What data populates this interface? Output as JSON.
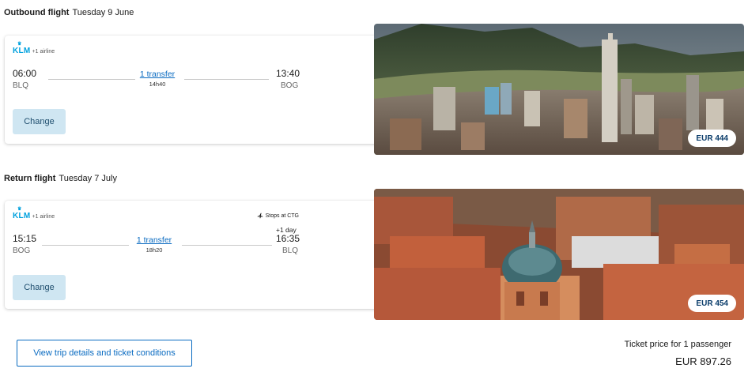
{
  "outbound": {
    "label": "Outbound flight",
    "date": "Tuesday 9 June",
    "airline_name": "KLM",
    "airline_extra": "+1 airline",
    "depart_time": "06:00",
    "depart_code": "BLQ",
    "arrive_time": "13:40",
    "arrive_code": "BOG",
    "transfer_label": "1 transfer",
    "duration": "14h40",
    "change_label": "Change",
    "price": "EUR 444"
  },
  "return": {
    "label": "Return flight",
    "date": "Tuesday 7 July",
    "airline_name": "KLM",
    "airline_extra": "+1 airline",
    "stops_note": "Stops at CTG",
    "depart_time": "15:15",
    "depart_code": "BOG",
    "arrive_time": "16:35",
    "arrive_code": "BLQ",
    "plus_day": "+1 day",
    "transfer_label": "1 transfer",
    "duration": "18h20",
    "change_label": "Change",
    "price": "EUR 454"
  },
  "footer": {
    "details_button": "View trip details and ticket conditions",
    "ticket_label": "Ticket price for 1 passenger",
    "total_price": "EUR 897.26"
  },
  "colors": {
    "accent": "#0a6bc1",
    "change_bg": "#cfe6f2",
    "klm_blue": "#00a1de"
  }
}
